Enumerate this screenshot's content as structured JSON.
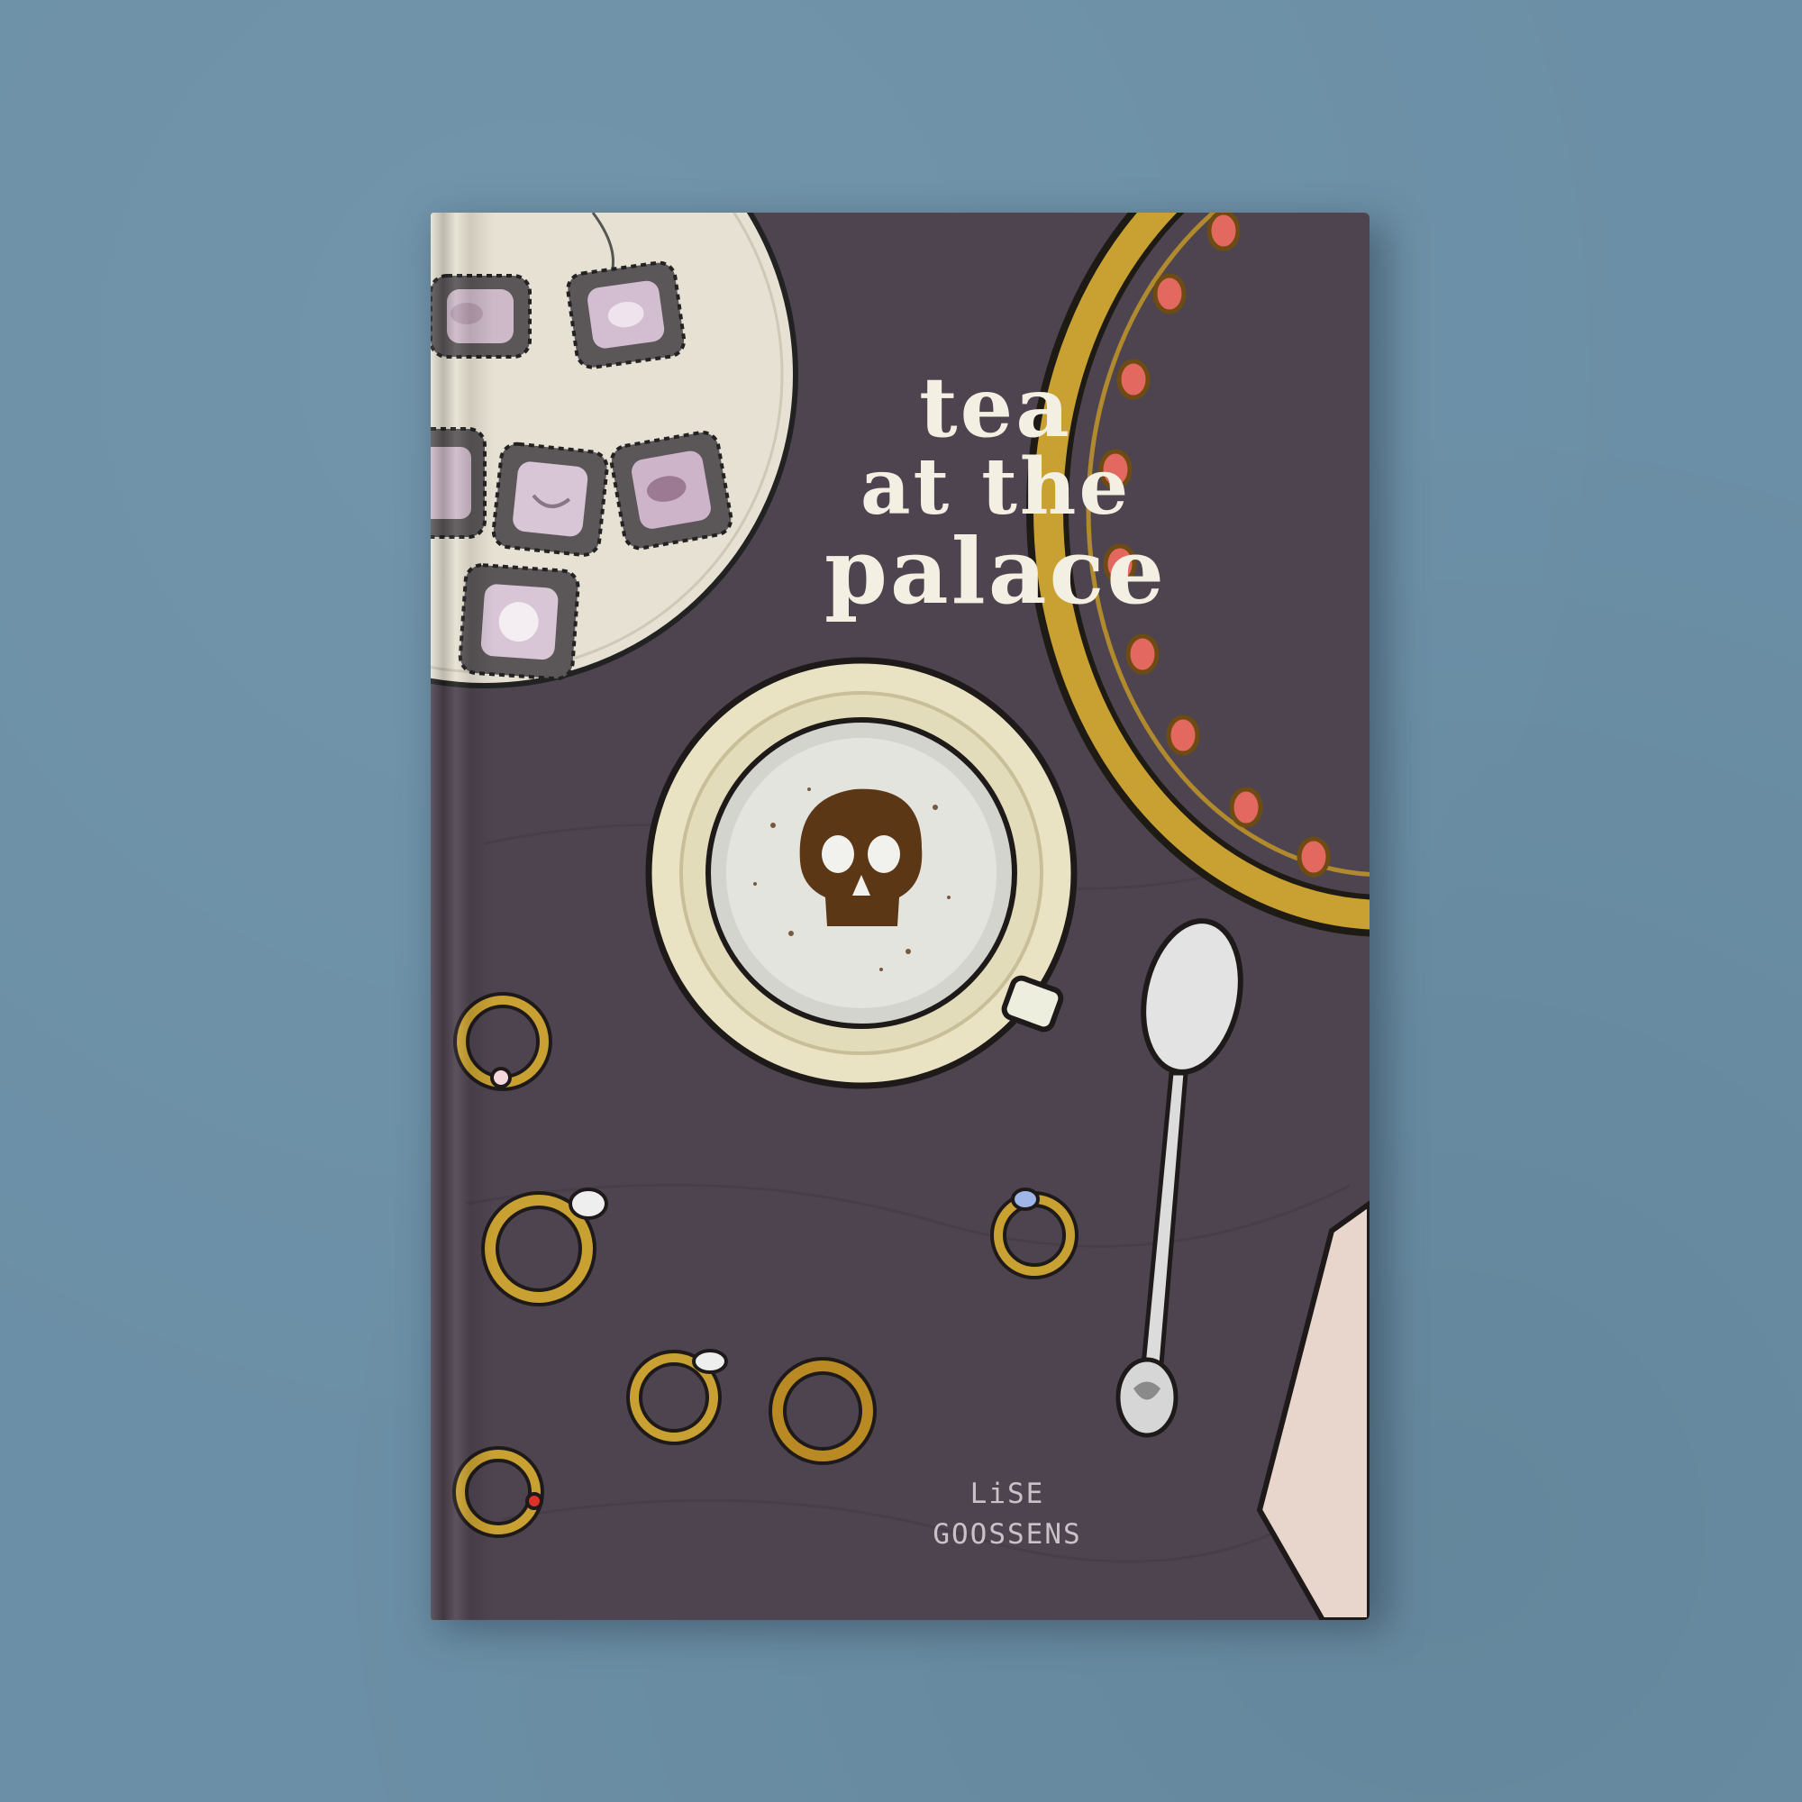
{
  "cover": {
    "title_lines": [
      "tea",
      "at the",
      "palace"
    ],
    "author_lines": [
      "LiSE",
      "GOOSSENS"
    ]
  },
  "colors": {
    "background": "#6b8fa6",
    "cover": "#4e4450",
    "plate": "#e6e1d2",
    "gold": "#c9a132",
    "gem_red": "#e3685f",
    "title_text": "#f3efe2",
    "author_text": "#c9c2c6"
  },
  "illustration": {
    "objects": [
      "plate-of-sweets",
      "ornate-gold-mirror",
      "teacup-with-skull",
      "silver-spoon",
      "gold-rings",
      "napkin"
    ]
  }
}
